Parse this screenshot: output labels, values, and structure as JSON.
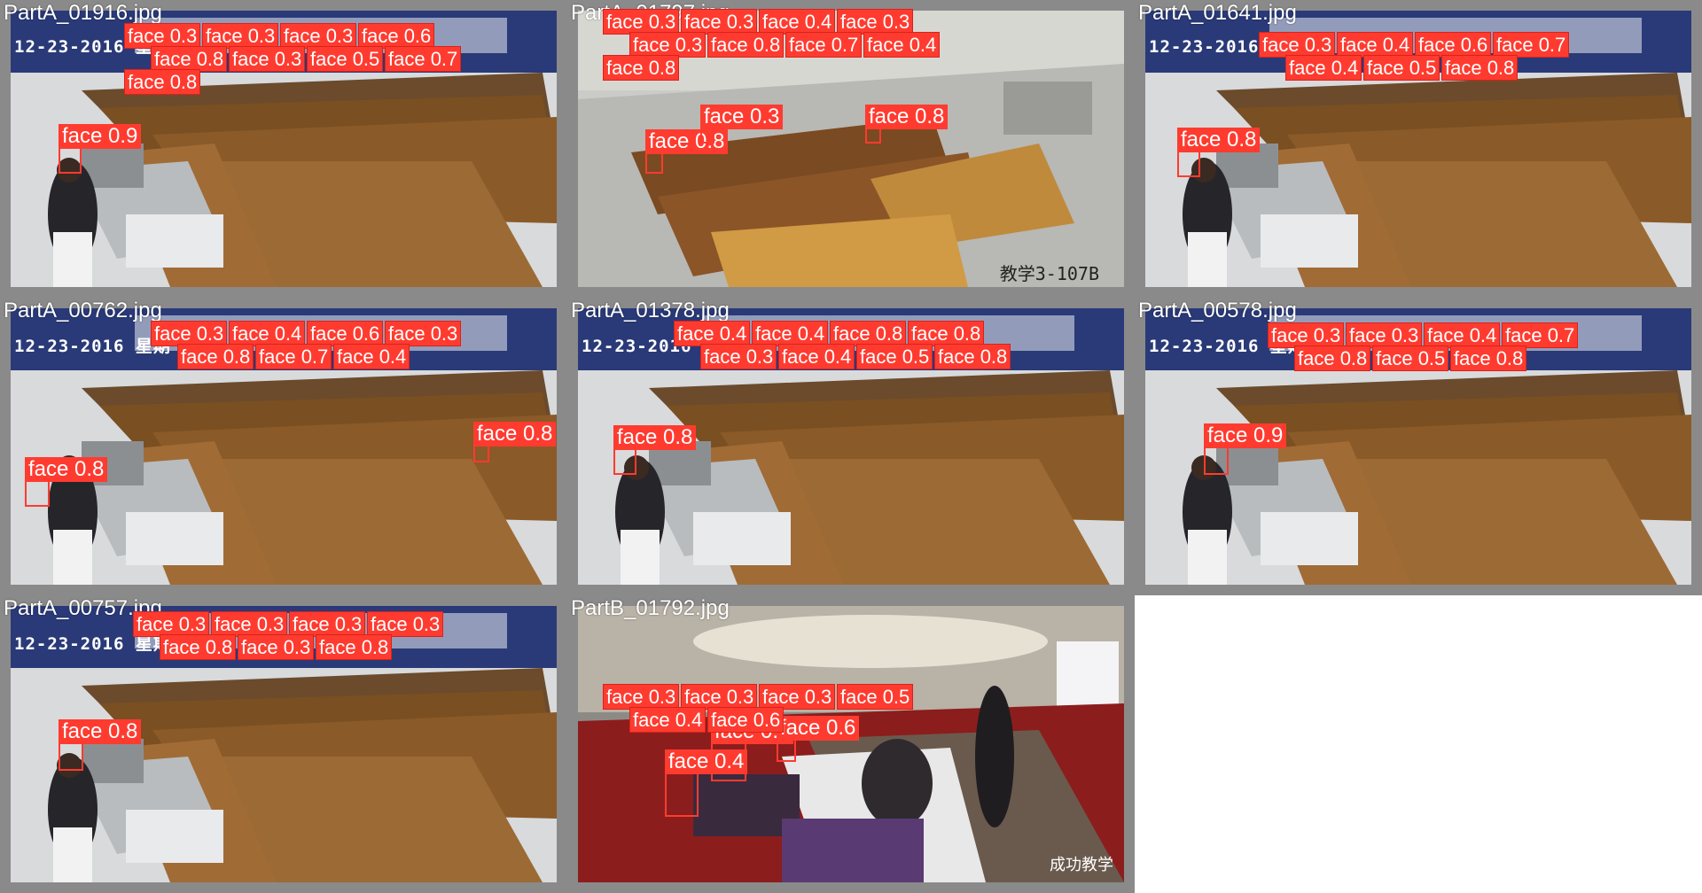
{
  "mosaic": {
    "tiles": [
      {
        "filename": "PartA_01916.jpg",
        "stamp": "12-23-2016  星期",
        "room": "",
        "watermark": "",
        "labels": [
          "face 0.9"
        ],
        "cluster": [
          "face 0.3",
          "face 0.3",
          "face 0.3",
          "face 0.6",
          "face 0.8",
          "face 0.3",
          "face 0.5",
          "face 0.7",
          "face 0.8"
        ]
      },
      {
        "filename": "PartA_01797.jpg",
        "stamp": "",
        "room": "教学3-107B",
        "watermark": "",
        "labels": [
          "face 0.8",
          "face 0.3",
          "face 0.8"
        ],
        "cluster": [
          "face 0.3",
          "face 0.3",
          "face 0.4",
          "face 0.3",
          "face 0.3",
          "face 0.8",
          "face 0.7",
          "face 0.4",
          "face 0.8"
        ]
      },
      {
        "filename": "PartA_01641.jpg",
        "stamp": "12-23-2016  星期",
        "room": "",
        "watermark": "",
        "labels": [
          "face 0.8"
        ],
        "cluster": [
          "face 0.3",
          "face 0.4",
          "face 0.6",
          "face 0.7",
          "face 0.4",
          "face 0.5",
          "face 0.8"
        ]
      },
      {
        "filename": "PartA_00762.jpg",
        "stamp": "12-23-2016  星期",
        "room": "",
        "watermark": "",
        "labels": [
          "face 0.8",
          "face 0.8"
        ],
        "cluster": [
          "face 0.3",
          "face 0.4",
          "face 0.6",
          "face 0.3",
          "face 0.8",
          "face 0.7",
          "face 0.4"
        ]
      },
      {
        "filename": "PartA_01378.jpg",
        "stamp": "12-23-2016  星期",
        "room": "",
        "watermark": "",
        "labels": [
          "face 0.8"
        ],
        "cluster": [
          "face 0.4",
          "face 0.4",
          "face 0.8",
          "face 0.8",
          "face 0.3",
          "face 0.4",
          "face 0.5",
          "face 0.8"
        ]
      },
      {
        "filename": "PartA_00578.jpg",
        "stamp": "12-23-2016  星期",
        "room": "",
        "watermark": "",
        "labels": [
          "face 0.9"
        ],
        "cluster": [
          "face 0.3",
          "face 0.3",
          "face 0.4",
          "face 0.7",
          "face 0.8",
          "face 0.5",
          "face 0.8"
        ]
      },
      {
        "filename": "PartA_00757.jpg",
        "stamp": "12-23-2016  星期",
        "room": "",
        "watermark": "",
        "labels": [
          "face 0.8"
        ],
        "cluster": [
          "face 0.3",
          "face 0.3",
          "face 0.3",
          "face 0.3",
          "face 0.8",
          "face 0.3",
          "face 0.8"
        ]
      },
      {
        "filename": "PartB_01792.jpg",
        "stamp": "",
        "room": "",
        "watermark": "成功教学",
        "labels": [
          "face 0.4",
          "face 0.4",
          "face 0.6"
        ],
        "cluster": [
          "face 0.3",
          "face 0.3",
          "face 0.3",
          "face 0.5",
          "face 0.4",
          "face 0.6"
        ]
      }
    ]
  },
  "colors": {
    "box": "#ff3b30",
    "label_text": "#ffffff",
    "tile_border": "#8a8a8a"
  }
}
